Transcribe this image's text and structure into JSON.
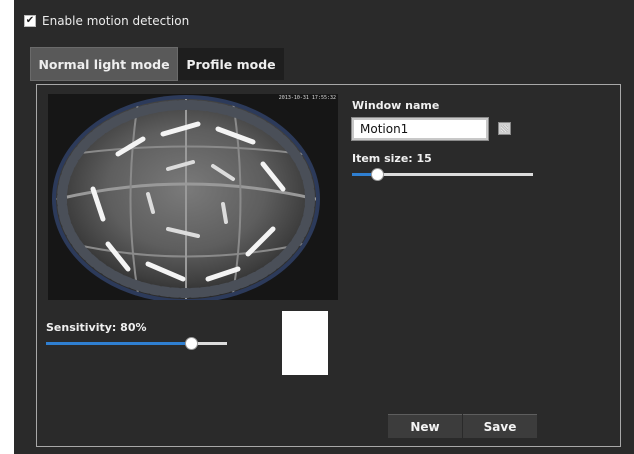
{
  "motion": {
    "enable_label": "Enable motion detection",
    "enabled": true
  },
  "tabs": [
    {
      "label": "Normal light mode",
      "active": true
    },
    {
      "label": "Profile mode",
      "active": false
    }
  ],
  "camera": {
    "timestamp": "2013-10-31 17:55:32"
  },
  "window": {
    "name_label": "Window name",
    "name_value": "Motion1",
    "item_size_label": "Item size: 15",
    "item_size_level": 0.14
  },
  "sensitivity": {
    "label": "Sensitivity: 80%",
    "level": 0.8
  },
  "buttons": {
    "new_label": "New",
    "save_label": "Save"
  },
  "colors": {
    "background": "#2a2a2a",
    "accent": "#2f7fd1",
    "tab_active": "#595959"
  },
  "icons": {
    "checkbox": "check-icon",
    "color_picker": "color-swatch-icon"
  }
}
